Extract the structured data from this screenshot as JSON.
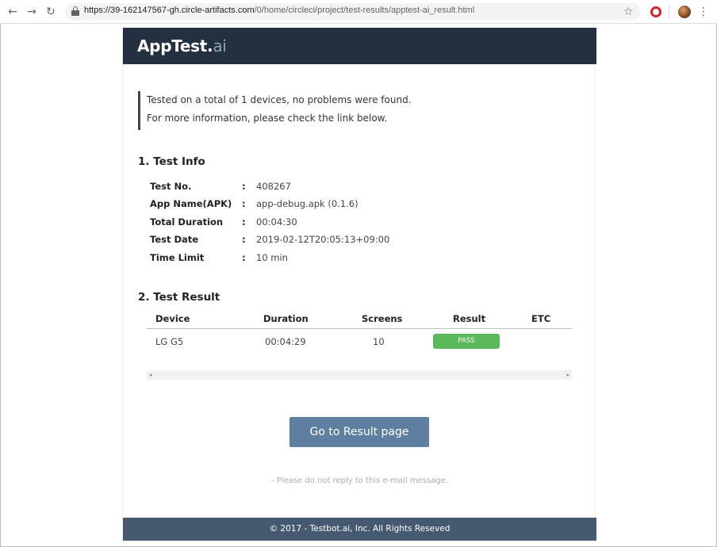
{
  "browser": {
    "back_icon": "←",
    "forward_icon": "→",
    "reload_icon": "↻",
    "url_host": "https://39-162147567-gh.circle-artifacts.com",
    "url_path": "/0/home/circleci/project/test-results/apptest-ai_result.html",
    "star_icon": "☆",
    "menu_icon": "⋮"
  },
  "header": {
    "logo_main": "AppTest.",
    "logo_suffix": "ai"
  },
  "notice": {
    "line1": "Tested on a total of 1 devices, no problems were found.",
    "line2": "For more information, please check the link below."
  },
  "test_info": {
    "title": "1. Test Info",
    "rows": [
      {
        "key": "Test No.",
        "colon": ":",
        "value": "408267"
      },
      {
        "key": "App Name(APK)",
        "colon": ":",
        "value": "app-debug.apk (0.1.6)"
      },
      {
        "key": "Total Duration",
        "colon": ":",
        "value": "00:04:30"
      },
      {
        "key": "Test Date",
        "colon": ":",
        "value": "2019-02-12T20:05:13+09:00"
      },
      {
        "key": "Time Limit",
        "colon": ":",
        "value": "10 min"
      }
    ]
  },
  "test_result": {
    "title": "2. Test Result",
    "columns": [
      "Device",
      "Duration",
      "Screens",
      "Result",
      "ETC"
    ],
    "rows": [
      {
        "device": "LG G5",
        "duration": "00:04:29",
        "screens": "10",
        "result": "PASS",
        "etc": ""
      }
    ],
    "scroll_left": "◂",
    "scroll_right": "▸",
    "pass_color": "#5cb85c"
  },
  "cta": {
    "label": "Go to Result page"
  },
  "noreply": "- Please do not reply to this e-mail message.",
  "footer": "© 2017 - Testbot.ai, Inc. All Rights Reseved",
  "colors": {
    "header_bg": "#23303f",
    "footer_bg": "#455a70",
    "button_bg": "#5f7fa0"
  }
}
